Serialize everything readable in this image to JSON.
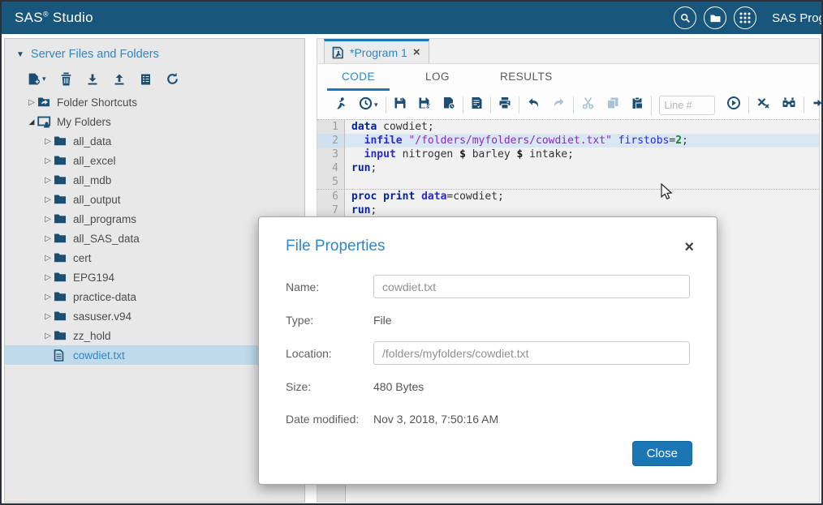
{
  "topbar": {
    "brand": "SAS",
    "brand_reg": "®",
    "brand_product": " Studio",
    "session_label": "SAS Progr",
    "icons": [
      "search-icon",
      "open-folder-icon",
      "apps-icon"
    ]
  },
  "sidebar": {
    "header": "Server Files and Folders",
    "toolbar": [
      {
        "icon": "new-file-icon",
        "caret": true
      },
      {
        "icon": "trash-icon"
      },
      {
        "icon": "download-icon"
      },
      {
        "icon": "upload-icon"
      },
      {
        "icon": "properties-icon"
      },
      {
        "icon": "refresh-icon"
      }
    ],
    "tree": [
      {
        "label": "Folder Shortcuts",
        "icon": "folder-shortcuts-icon",
        "level": 1,
        "state": "collapsed"
      },
      {
        "label": "My Folders",
        "icon": "my-folders-icon",
        "level": 1,
        "state": "expanded"
      },
      {
        "label": "all_data",
        "icon": "folder-icon",
        "level": 2,
        "state": "collapsed"
      },
      {
        "label": "all_excel",
        "icon": "folder-icon",
        "level": 2,
        "state": "collapsed"
      },
      {
        "label": "all_mdb",
        "icon": "folder-icon",
        "level": 2,
        "state": "collapsed"
      },
      {
        "label": "all_output",
        "icon": "folder-icon",
        "level": 2,
        "state": "collapsed"
      },
      {
        "label": "all_programs",
        "icon": "folder-icon",
        "level": 2,
        "state": "collapsed"
      },
      {
        "label": "all_SAS_data",
        "icon": "folder-icon",
        "level": 2,
        "state": "collapsed"
      },
      {
        "label": "cert",
        "icon": "folder-icon",
        "level": 2,
        "state": "collapsed"
      },
      {
        "label": "EPG194",
        "icon": "folder-icon",
        "level": 2,
        "state": "collapsed"
      },
      {
        "label": "practice-data",
        "icon": "folder-icon",
        "level": 2,
        "state": "collapsed"
      },
      {
        "label": "sasuser.v94",
        "icon": "folder-icon",
        "level": 2,
        "state": "collapsed"
      },
      {
        "label": "zz_hold",
        "icon": "folder-icon",
        "level": 2,
        "state": "collapsed"
      },
      {
        "label": "cowdiet.txt",
        "icon": "file-icon",
        "level": 2,
        "state": "none",
        "selected": true
      }
    ]
  },
  "main": {
    "tab_label": "*Program 1",
    "tab_close_glyph": "×",
    "subtabs": [
      {
        "label": "CODE",
        "active": true
      },
      {
        "label": "LOG",
        "active": false
      },
      {
        "label": "RESULTS",
        "active": false
      }
    ],
    "toolbar_groups": [
      [
        {
          "icon": "run-icon"
        },
        {
          "icon": "submission-history-icon",
          "caret": true
        }
      ],
      [
        {
          "icon": "save-icon"
        },
        {
          "icon": "save-as-icon"
        },
        {
          "icon": "program-history-icon"
        }
      ],
      [
        {
          "icon": "edit-doc-icon"
        }
      ],
      [
        {
          "icon": "print-icon"
        }
      ],
      [
        {
          "icon": "undo-icon"
        },
        {
          "icon": "redo-icon",
          "disabled": true
        }
      ],
      [
        {
          "icon": "cut-icon",
          "disabled": true
        },
        {
          "icon": "copy-icon",
          "disabled": true
        },
        {
          "icon": "paste-icon"
        }
      ],
      [
        {
          "input": true
        },
        {
          "icon": "go-to-line-icon"
        }
      ],
      [
        {
          "icon": "clear-code-icon"
        },
        {
          "icon": "find-replace-icon"
        }
      ],
      [
        {
          "icon": "format-code-icon"
        }
      ]
    ],
    "line_number_placeholder": "Line #",
    "code_lines": [
      {
        "num": "1",
        "sep": true,
        "hl": false,
        "segments": [
          [
            "data",
            "step"
          ],
          [
            " cowdiet;",
            "plain"
          ]
        ]
      },
      {
        "num": "2",
        "sep": false,
        "hl": true,
        "segments": [
          [
            "  ",
            "plain"
          ],
          [
            "infile",
            "stmt"
          ],
          [
            " ",
            "plain"
          ],
          [
            "\"/folders/myfolders/cowdiet.txt\"",
            "str"
          ],
          [
            " ",
            "plain"
          ],
          [
            "firstobs",
            "opt"
          ],
          [
            "=",
            "plain"
          ],
          [
            "2",
            "num"
          ],
          [
            ";",
            "plain"
          ]
        ]
      },
      {
        "num": "3",
        "sep": false,
        "hl": false,
        "segments": [
          [
            "  ",
            "plain"
          ],
          [
            "input",
            "stmt"
          ],
          [
            " nitrogen ",
            "plain"
          ],
          [
            "$",
            "sym"
          ],
          [
            " barley ",
            "plain"
          ],
          [
            "$",
            "sym"
          ],
          [
            " intake;",
            "plain"
          ]
        ]
      },
      {
        "num": "4",
        "sep": false,
        "hl": false,
        "segments": [
          [
            "run",
            "step"
          ],
          [
            ";",
            "plain"
          ]
        ]
      },
      {
        "num": "5",
        "sep": false,
        "hl": false,
        "segments": []
      },
      {
        "num": "6",
        "sep": true,
        "hl": false,
        "segments": [
          [
            "proc print",
            "step"
          ],
          [
            " ",
            "plain"
          ],
          [
            "data",
            "stmt"
          ],
          [
            "=cowdiet;",
            "plain"
          ]
        ]
      },
      {
        "num": "7",
        "sep": false,
        "hl": false,
        "segments": [
          [
            "run",
            "step"
          ],
          [
            ";",
            "plain"
          ]
        ]
      }
    ]
  },
  "dialog": {
    "title": "File Properties",
    "close_glyph": "×",
    "fields": [
      {
        "label": "Name:",
        "value": "cowdiet.txt",
        "kind": "input"
      },
      {
        "label": "Type:",
        "value": "File",
        "kind": "text"
      },
      {
        "label": "Location:",
        "value": "/folders/myfolders/cowdiet.txt",
        "kind": "input"
      },
      {
        "label": "Size:",
        "value": "480 Bytes",
        "kind": "text"
      },
      {
        "label": "Date modified:",
        "value": "Nov 3, 2018, 7:50:16 AM",
        "kind": "text"
      }
    ],
    "close_button": "Close"
  },
  "colors": {
    "topbar_bg": "#19567C",
    "accent_blue": "#2E87C8",
    "tab_accent": "#1F77B4",
    "icon_navy": "#1D4E74",
    "selection_bg": "#BFDAEB",
    "line_highlight": "#D9E7F5",
    "keyword_step": "#00249C",
    "keyword_statement": "#2A2AD4",
    "string_literal": "#8A2BB8",
    "number_literal": "#1F7D1F",
    "primary_button_bg": "#1B77B4"
  }
}
